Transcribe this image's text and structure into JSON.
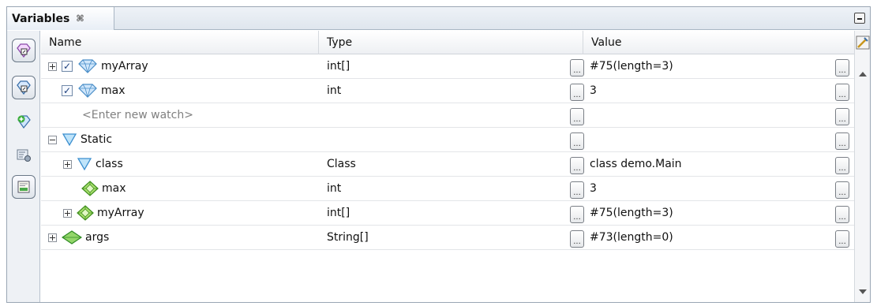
{
  "panel": {
    "tab_title": "Variables",
    "tab_close_glyph": "⌘"
  },
  "columns": {
    "name": "Name",
    "type": "Type",
    "value": "Value"
  },
  "toolbar": {
    "icons": [
      "gem-filter-icon",
      "gem-filter-icon",
      "new-watch-icon",
      "settings-icon",
      "view-icon"
    ]
  },
  "rows": [
    {
      "name": "myArray",
      "type": "int[]",
      "value": "#75(length=3)"
    },
    {
      "name": "max",
      "type": "int",
      "value": "3"
    },
    {
      "name": "<Enter new watch>",
      "type": "",
      "value": ""
    },
    {
      "name": "Static",
      "type": "",
      "value": ""
    },
    {
      "name": "class",
      "type": "Class",
      "value": "class demo.Main"
    },
    {
      "name": "max",
      "type": "int",
      "value": "3"
    },
    {
      "name": "myArray",
      "type": "int[]",
      "value": "#75(length=3)"
    },
    {
      "name": "args",
      "type": "String[]",
      "value": "#73(length=0)"
    }
  ],
  "customizer_button_glyph": "...",
  "colors": {
    "watch_icon": "#6fb3e6",
    "static_icon": "#8cc8ee",
    "field_icon": "#6cbf3a",
    "local_icon": "#58b848"
  }
}
